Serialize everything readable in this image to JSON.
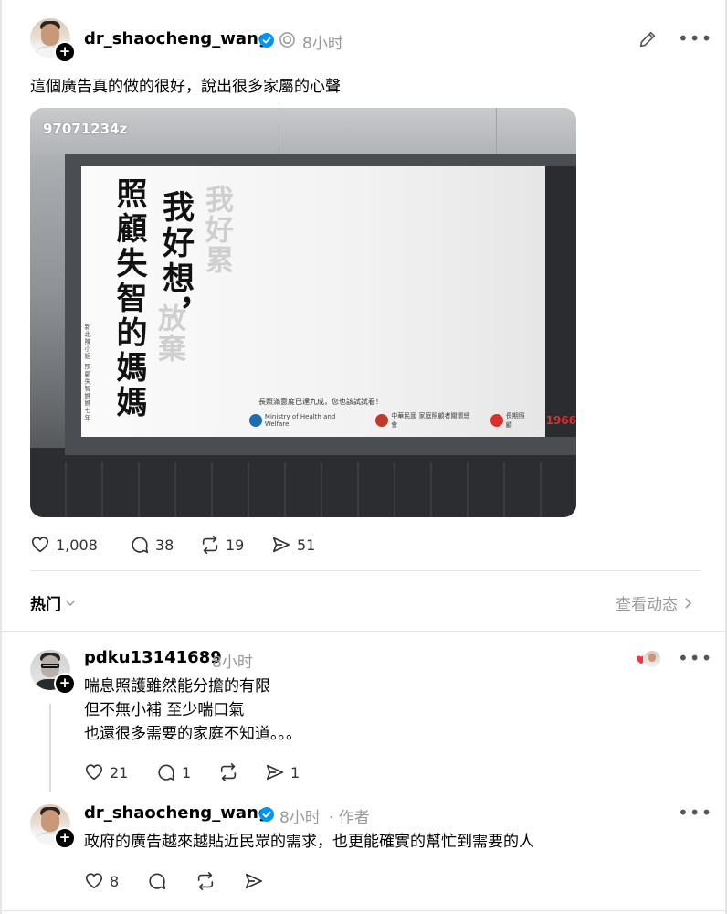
{
  "post": {
    "username": "dr_shaocheng_wang",
    "time": "8小时",
    "text": "這個廣告真的做的很好，說出很多家屬的心聲",
    "image": {
      "watermark": "97071234z",
      "billboard_main": "我好想，",
      "billboard_faded_1": "我好累",
      "billboard_faded_2": "放棄",
      "billboard_line1": "照顧失智的媽媽",
      "billboard_caption": "新北陳小姐 照顧失智媽媽七年",
      "billboard_slogan": "長照滿意度已達九成，您也該試試看！",
      "billboard_logo1": "Ministry of Health and Welfare",
      "billboard_logo2": "中華民國 家庭照顧者關懷總會",
      "billboard_logo3": "長期照顧",
      "billboard_logo4": "1966"
    },
    "likes": "1,008",
    "replies": "38",
    "reposts": "19",
    "shares": "51"
  },
  "section": {
    "sort_label": "热门",
    "activity_label": "查看动态"
  },
  "comments": [
    {
      "username": "pdku13141689",
      "time": "8小时",
      "lines": [
        "喘息照護雖然能分擔的有限",
        "但不無小補 至少喘口氣",
        "也還很多需要的家庭不知道。。。"
      ],
      "likes": "21",
      "replies": "1",
      "shares": "1"
    },
    {
      "username": "dr_shaocheng_wang",
      "time": "8小时",
      "author_tag": "· 作者",
      "text": "政府的廣告越來越貼近民眾的需求，也更能確實的幫忙到需要的人",
      "likes": "8"
    }
  ],
  "colors": {
    "verified": "#0095f6",
    "muted": "#999999",
    "heart": "#ff3040"
  }
}
